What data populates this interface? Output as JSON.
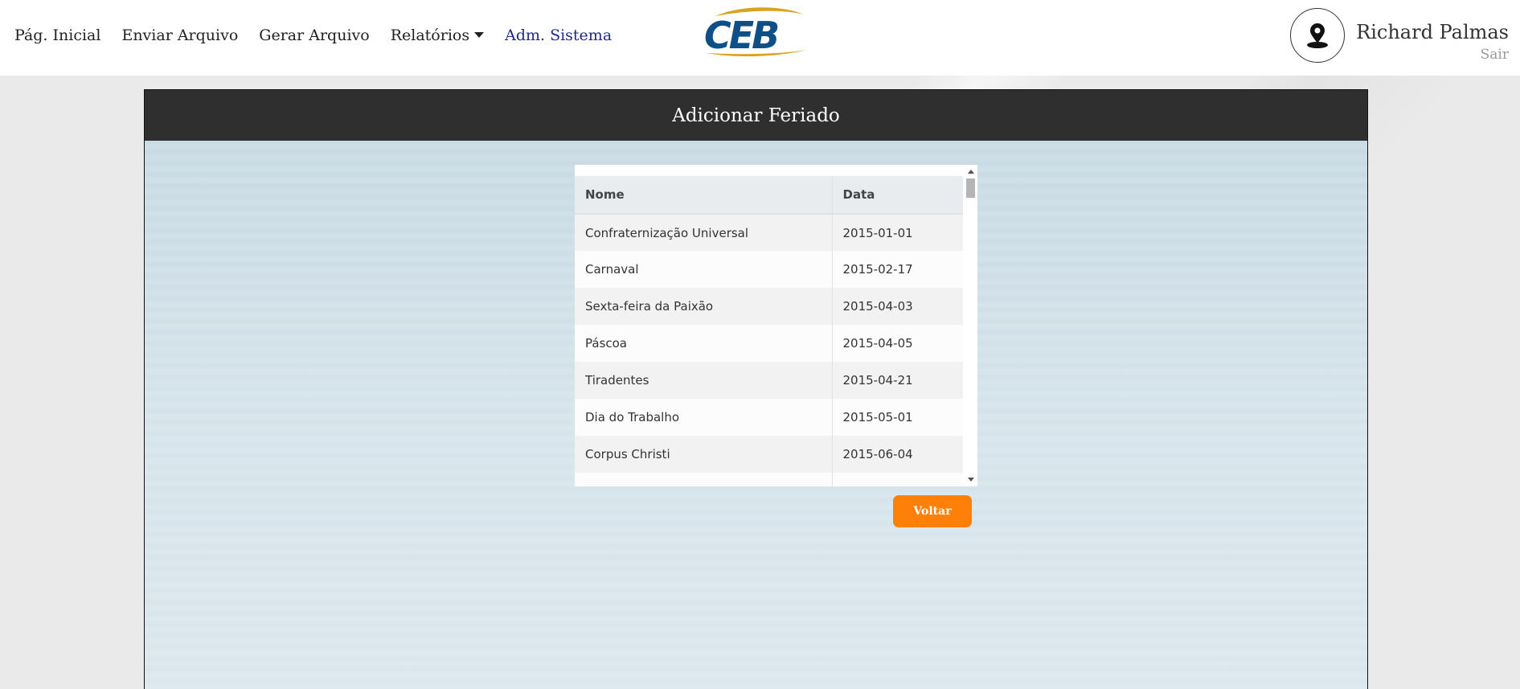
{
  "nav": {
    "items": [
      {
        "label": "Pág. Inicial"
      },
      {
        "label": "Enviar Arquivo"
      },
      {
        "label": "Gerar Arquivo"
      },
      {
        "label": "Relatórios"
      },
      {
        "label": "Adm. Sistema"
      }
    ]
  },
  "logo": {
    "text": "CEB"
  },
  "user": {
    "name": "Richard Palmas",
    "logout": "Sair"
  },
  "panel": {
    "title": "Adicionar Feriado"
  },
  "table": {
    "headers": [
      "Nome",
      "Data"
    ],
    "rows": [
      {
        "nome": "Confraternização Universal",
        "data": "2015-01-01"
      },
      {
        "nome": "Carnaval",
        "data": "2015-02-17"
      },
      {
        "nome": "Sexta-feira da Paixão",
        "data": "2015-04-03"
      },
      {
        "nome": "Páscoa",
        "data": "2015-04-05"
      },
      {
        "nome": "Tiradentes",
        "data": "2015-04-21"
      },
      {
        "nome": "Dia do Trabalho",
        "data": "2015-05-01"
      },
      {
        "nome": "Corpus Christi",
        "data": "2015-06-04"
      }
    ]
  },
  "buttons": {
    "back": "Voltar"
  },
  "colors": {
    "accent": "#ff8009",
    "panel_header": "#2f2f2f",
    "logo_blue": "#0d4f86",
    "logo_gold": "#d9a320",
    "active_nav": "#1f2a8a"
  }
}
